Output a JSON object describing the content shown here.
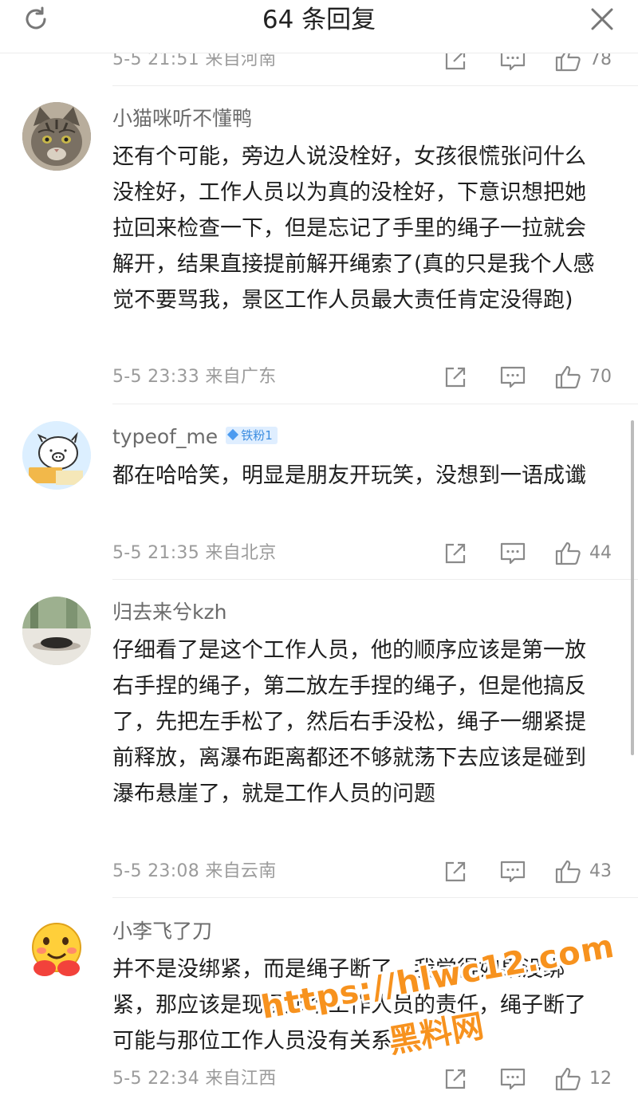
{
  "header": {
    "title": "64 条回复"
  },
  "top_meta": {
    "time": "5-5 21:51 来自河南",
    "likes": "78"
  },
  "comments": [
    {
      "username": "小猫咪听不懂鸭",
      "text": "还有个可能，旁边人说没栓好，女孩很慌张问什么没栓好，工作人员以为真的没栓好，下意识想把她拉回来检查一下，但是忘记了手里的绳子一拉就会解开，结果直接提前解开绳索了(真的只是我个人感觉不要骂我，景区工作人员最大责任肯定没得跑)",
      "time": "5-5 23:33 来自广东",
      "likes": "70"
    },
    {
      "username": "typeof_me",
      "badge": "铁粉1",
      "text": "都在哈哈笑，明显是朋友开玩笑，没想到一语成谶",
      "time": "5-5 21:35 来自北京",
      "likes": "44"
    },
    {
      "username": "归去来兮kzh",
      "text": "仔细看了是这个工作人员，他的顺序应该是第一放右手捏的绳子，第二放左手捏的绳子，但是他搞反了，先把左手松了，然后右手没松，绳子一绷紧提前释放，离瀑布距离都还不够就荡下去应该是碰到瀑布悬崖了，就是工作人员的问题",
      "time": "5-5 23:08 来自云南",
      "likes": "43"
    },
    {
      "username": "小李飞了刀",
      "text": "并不是没绑紧，而是绳子断了，我觉得如果没绑紧，那应该是现场那个工作人员的责任，绳子断了可能与那位工作人员没有关系。",
      "time": "5-5 22:34 来自江西",
      "likes": "12"
    }
  ],
  "watermark": {
    "url": "https://hlwc12.com",
    "name": "黑料网"
  }
}
